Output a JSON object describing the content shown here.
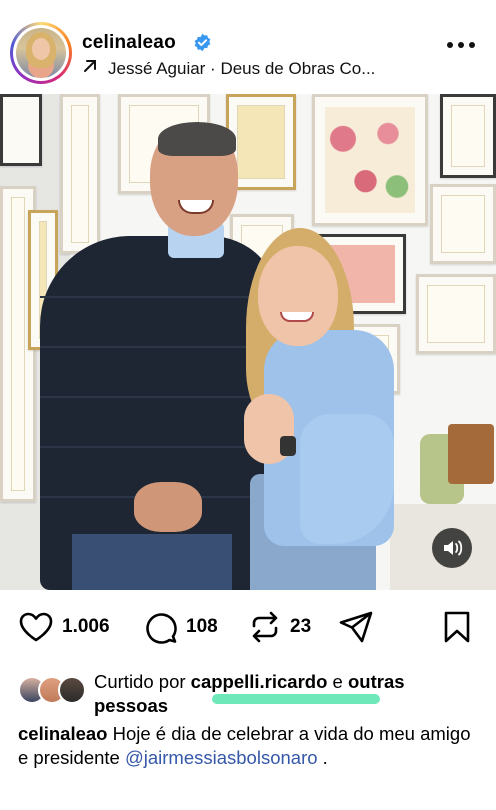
{
  "header": {
    "username": "celinaleao",
    "music_text": "Jessé Aguiar · Deus de Obras Co..."
  },
  "actions": {
    "likes": "1.006",
    "comments": "108",
    "reposts": "23"
  },
  "liked_by": {
    "prefix": "Curtido por",
    "user": "cappelli.ricardo",
    "connector": "e",
    "others": "outras",
    "others_cont": "pessoas"
  },
  "caption": {
    "username": "celinaleao",
    "text": "Hoje é dia de celebrar a vida do meu amigo e presidente",
    "mention": "@jairmessiasbolsonaro",
    "trailing": "."
  },
  "colors": {
    "mention": "#3558a8",
    "verified": "#3897f0",
    "highlight": "#5ee6b0"
  }
}
